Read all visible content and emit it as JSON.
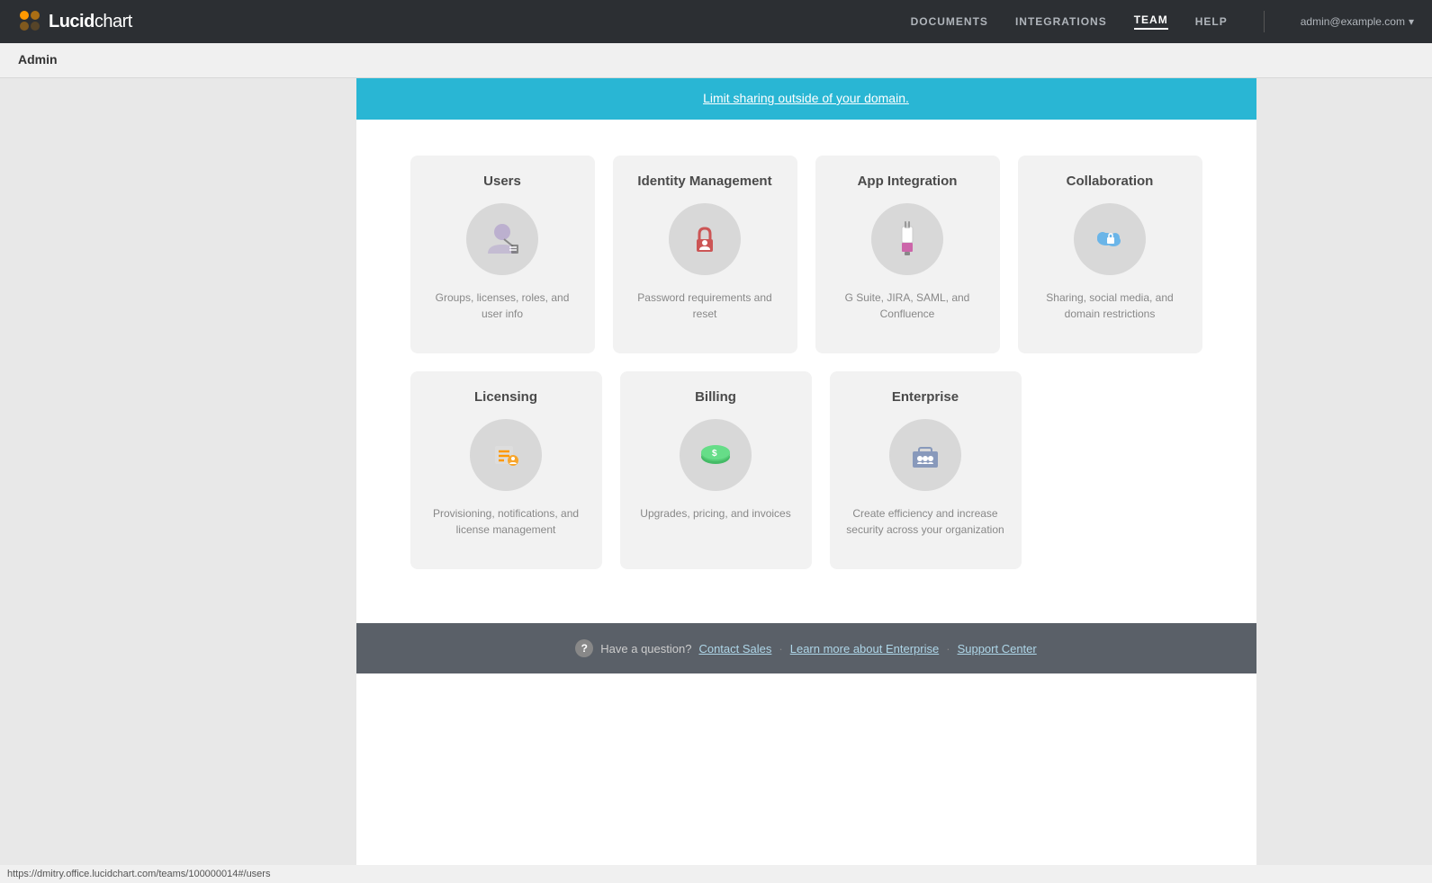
{
  "nav": {
    "logo_lucid": "Lucid",
    "logo_chart": "chart",
    "links": [
      {
        "label": "DOCUMENTS",
        "active": false
      },
      {
        "label": "INTEGRATIONS",
        "active": false
      },
      {
        "label": "TEAM",
        "active": true
      },
      {
        "label": "HELP",
        "active": false
      }
    ],
    "user": "admin@example.com"
  },
  "admin_bar": {
    "title": "Admin"
  },
  "banner": {
    "text": "Limit sharing outside of your domain."
  },
  "cards_row1": [
    {
      "id": "users",
      "title": "Users",
      "description": "Groups, licenses, roles, and user info"
    },
    {
      "id": "identity-management",
      "title": "Identity Management",
      "description": "Password requirements and reset"
    },
    {
      "id": "app-integration",
      "title": "App Integration",
      "description": "G Suite, JIRA, SAML, and Confluence"
    },
    {
      "id": "collaboration",
      "title": "Collaboration",
      "description": "Sharing, social media, and domain restrictions"
    }
  ],
  "cards_row2": [
    {
      "id": "licensing",
      "title": "Licensing",
      "description": "Provisioning, notifications, and license management"
    },
    {
      "id": "billing",
      "title": "Billing",
      "description": "Upgrades, pricing, and invoices"
    },
    {
      "id": "enterprise",
      "title": "Enterprise",
      "description": "Create efficiency and increase security across your organization"
    }
  ],
  "footer": {
    "question_label": "Have a question?",
    "links": [
      {
        "label": "Contact Sales"
      },
      {
        "label": "Learn more about Enterprise"
      },
      {
        "label": "Support Center"
      }
    ]
  },
  "status_bar": {
    "url": "https://dmitry.office.lucidchart.com/teams/100000014#/users"
  }
}
